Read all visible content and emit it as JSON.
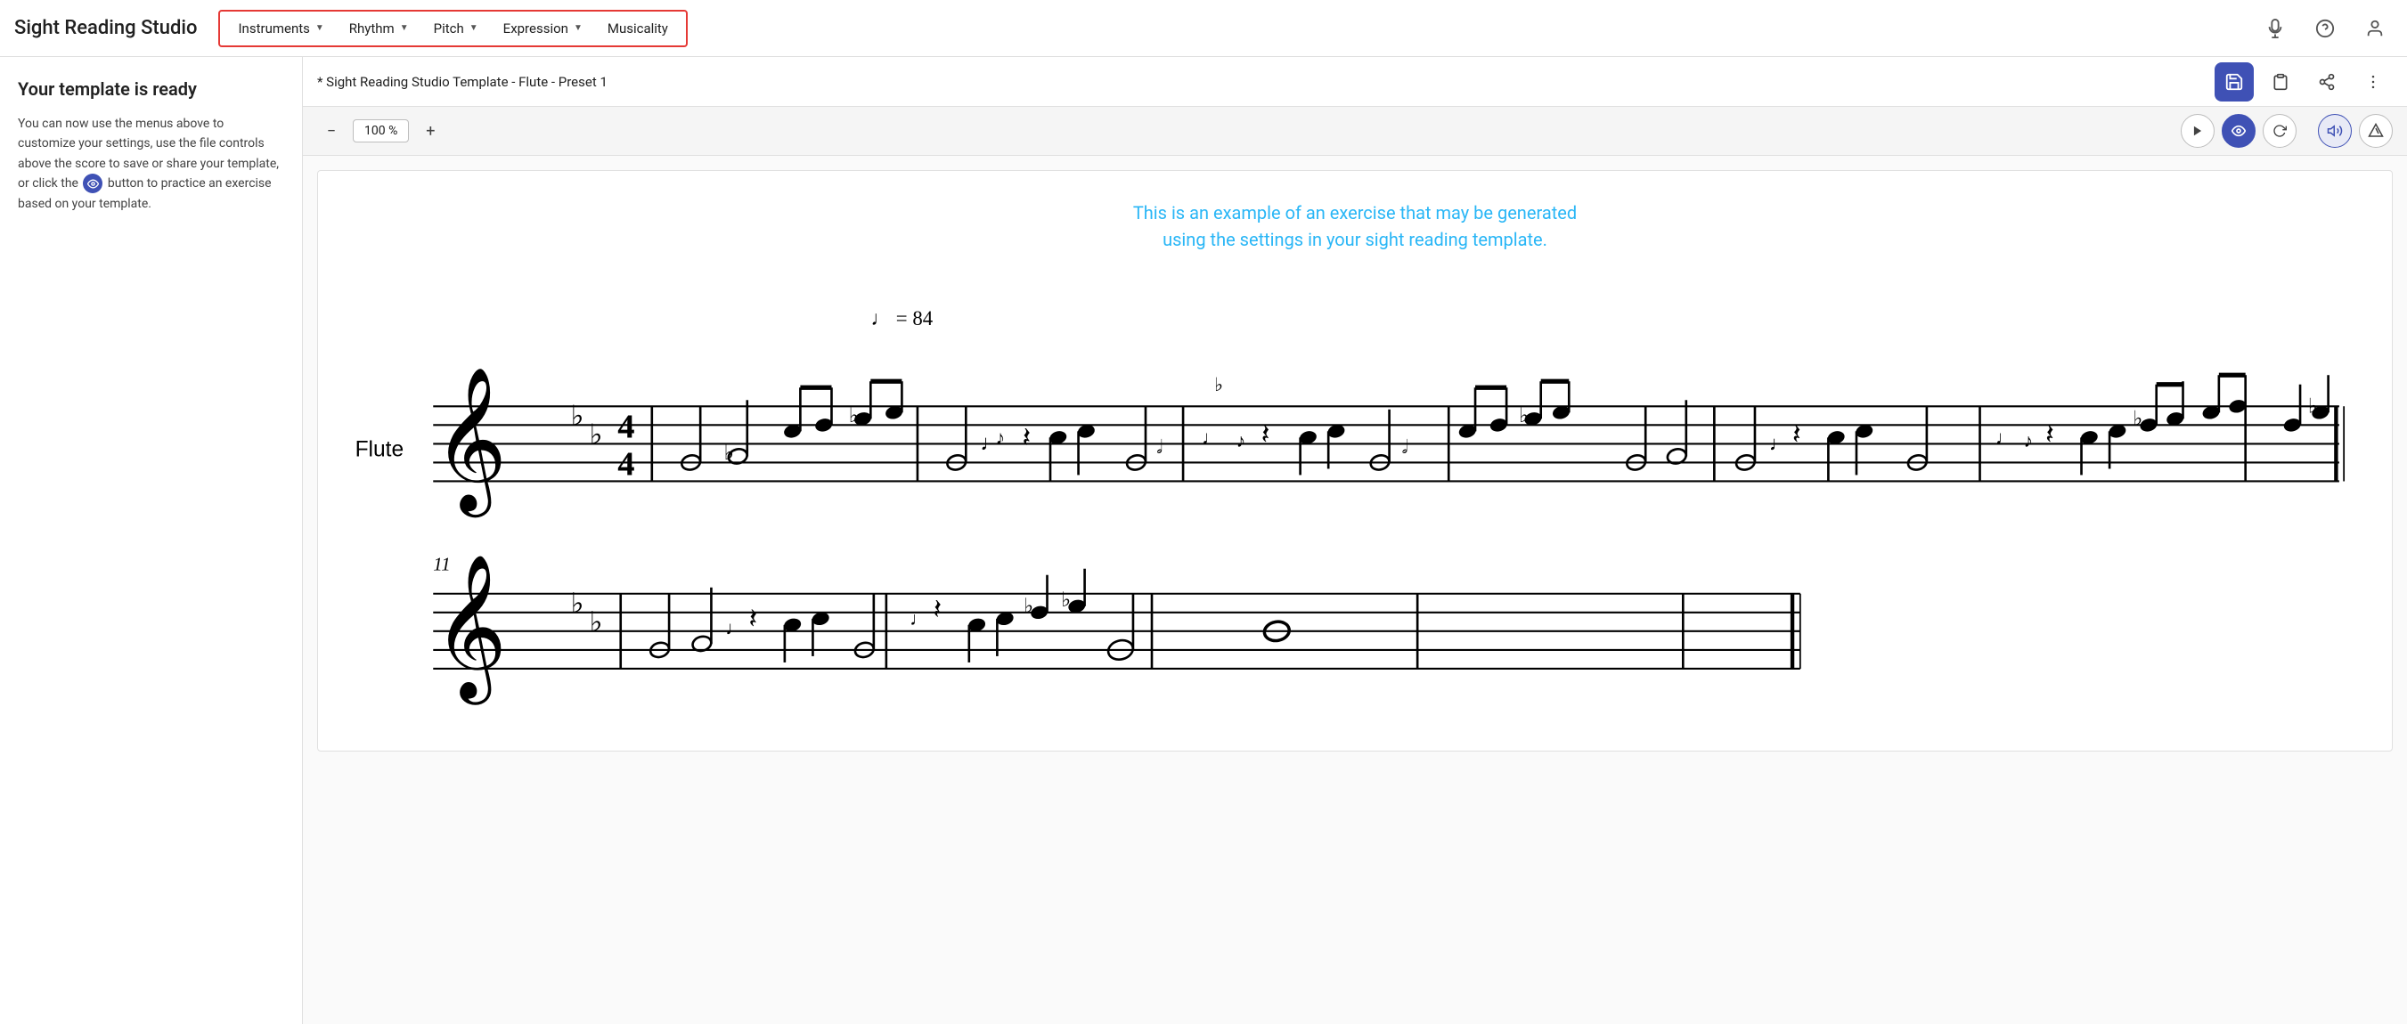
{
  "app": {
    "title": "Sight Reading Studio"
  },
  "nav": {
    "items": [
      {
        "label": "Instruments",
        "has_dropdown": true
      },
      {
        "label": "Rhythm",
        "has_dropdown": true
      },
      {
        "label": "Pitch",
        "has_dropdown": true
      },
      {
        "label": "Expression",
        "has_dropdown": true
      },
      {
        "label": "Musicality",
        "has_dropdown": false
      }
    ]
  },
  "header_icons": {
    "mic": "🎤",
    "help": "?",
    "account": "👤"
  },
  "sidebar": {
    "title": "Your template is ready",
    "description_parts": [
      "You can now use the menus above to customize your settings, use the file controls above the score to save or share your template, or click the",
      "button to practice an exercise based on your template."
    ]
  },
  "score": {
    "title": "* Sight Reading Studio Template - Flute - Preset 1"
  },
  "toolbar": {
    "zoom_value": "100 %",
    "zoom_minus": "−",
    "zoom_plus": "+"
  },
  "score_content": {
    "example_text_line1": "This is an example of an exercise that may be generated",
    "example_text_line2": "using the settings in your sight reading template."
  },
  "buttons": {
    "save_label": "💾",
    "clipboard_label": "📋",
    "share_label": "🔗",
    "more_label": "⋮"
  }
}
